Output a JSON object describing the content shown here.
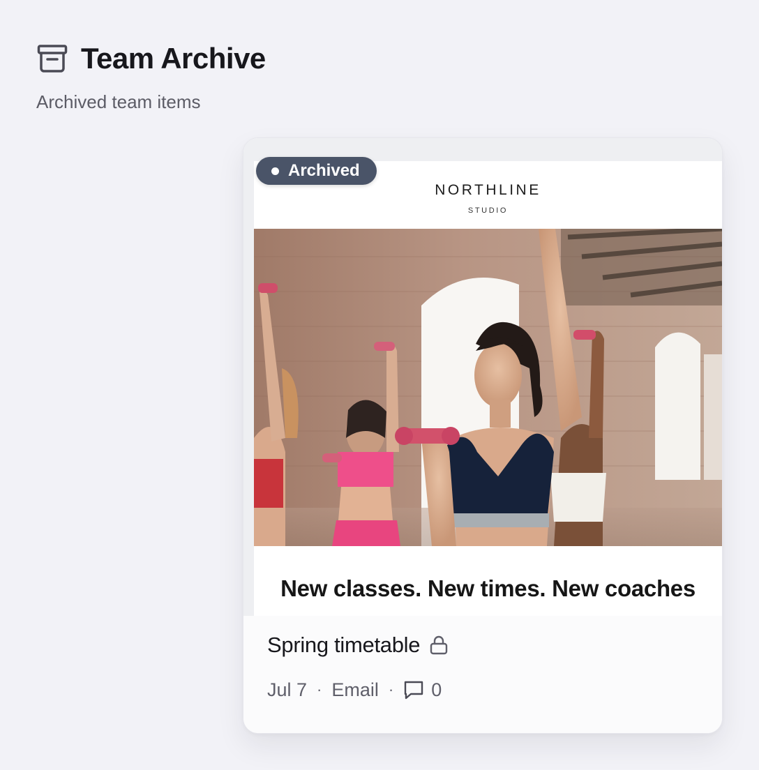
{
  "header": {
    "title": "Team Archive",
    "subtitle": "Archived team items",
    "icon": "archive-box-icon"
  },
  "card": {
    "status_badge": "Archived",
    "preview": {
      "brand_name": "NORTHLINE",
      "brand_tagline": "STUDIO",
      "hero_image": "fitness-class-dumbbells-photo",
      "headline": "New classes. New times. New coaches"
    },
    "title": "Spring timetable",
    "locked": true,
    "lock_icon": "lock-icon",
    "date": "Jul 7",
    "type": "Email",
    "comment_icon": "comment-icon",
    "comment_count": "0"
  },
  "colors": {
    "background": "#f2f2f7",
    "badge": "#4a5468",
    "title_text": "#17171c",
    "meta_text": "#5f5f6a"
  }
}
